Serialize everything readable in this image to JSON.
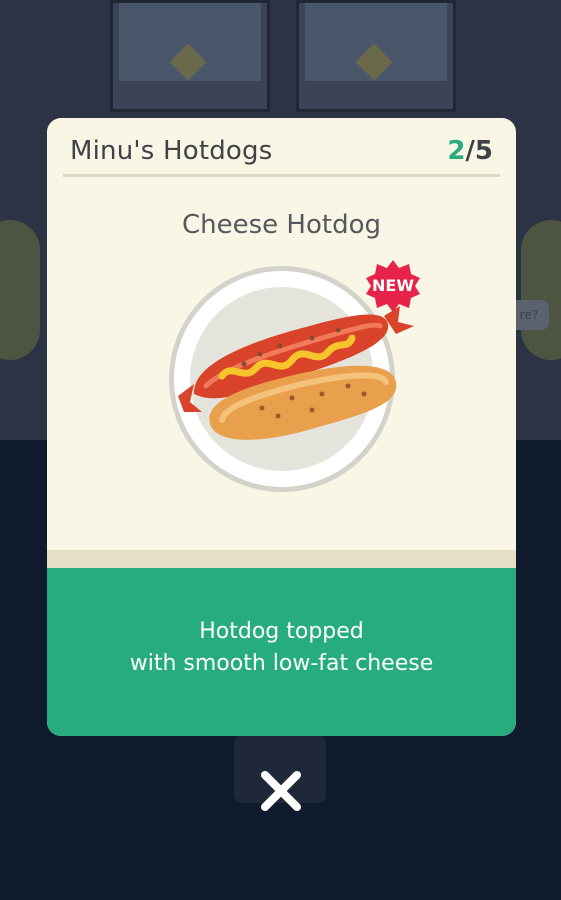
{
  "card": {
    "title": "Minu's Hotdogs",
    "count_current": "2",
    "count_total": "/5",
    "item_name": "Cheese Hotdog",
    "badge": "NEW",
    "description_line1": "Hotdog topped",
    "description_line2": "with smooth low-fat cheese"
  },
  "background": {
    "bubble_text": "re?"
  },
  "icons": {
    "close": "close-icon",
    "hotdog": "hotdog-illustration",
    "new_badge": "new-badge-icon"
  },
  "colors": {
    "accent_green": "#27ad7d",
    "card_bg": "#faf6e6",
    "badge_red": "#e8234a",
    "overlay": "#0f1a2c"
  }
}
